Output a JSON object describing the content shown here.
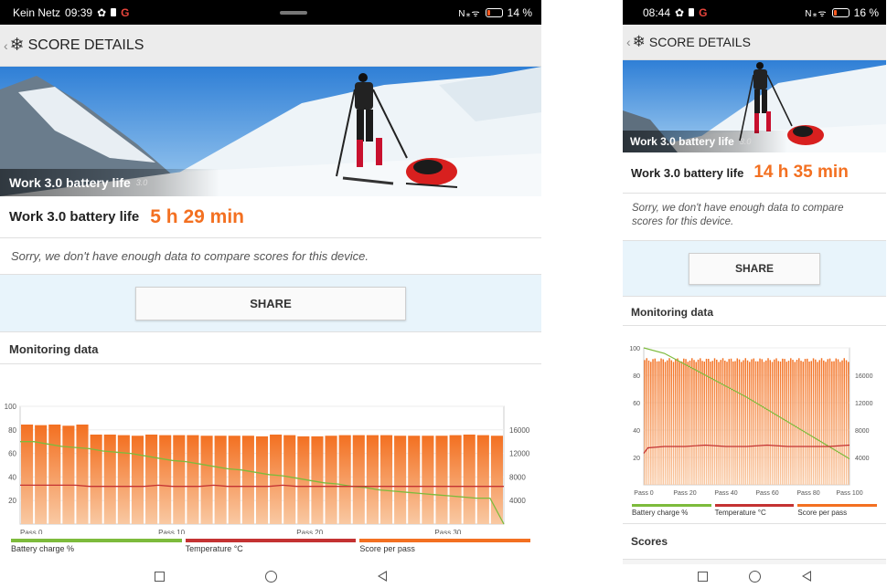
{
  "colors": {
    "accent": "#f37021",
    "battery_line": "#7dbb3c",
    "temp_line": "#c43232",
    "share_bg": "#e8f4fb"
  },
  "left": {
    "status": {
      "carrier": "Kein Netz",
      "time": "09:39",
      "icons": "N⁎ᯤ",
      "battery": "14 %"
    },
    "appbar": {
      "title": "SCORE DETAILS"
    },
    "hero": {
      "label": "Work 3.0 battery life",
      "version": "3.0"
    },
    "score": {
      "label": "Work 3.0 battery life",
      "value": "5 h 29 min"
    },
    "note": "Sorry, we don't have enough data to compare scores for this device.",
    "share_label": "SHARE",
    "monitoring_title": "Monitoring data",
    "legend": {
      "battery": "Battery charge %",
      "temperature": "Temperature °C",
      "score": "Score per pass"
    }
  },
  "right": {
    "status": {
      "time": "08:44",
      "icons": "N⁎ᯤ",
      "battery": "16 %"
    },
    "appbar": {
      "title": "SCORE DETAILS"
    },
    "hero": {
      "label": "Work 3.0 battery life",
      "version": "3.0"
    },
    "score": {
      "label": "Work 3.0 battery life",
      "value": "14 h 35 min"
    },
    "note": "Sorry, we don't have enough data to compare scores for this device.",
    "share_label": "SHARE",
    "monitoring_title": "Monitoring data",
    "legend": {
      "battery": "Battery charge %",
      "temperature": "Temperature °C",
      "score": "Score per pass"
    },
    "scores_title": "Scores"
  },
  "chart_data": [
    {
      "type": "bar",
      "series": [
        {
          "name": "Score per pass",
          "axis": "right",
          "values": [
            16900,
            16800,
            16900,
            16700,
            16900,
            15200,
            15200,
            15100,
            15000,
            15200,
            15100,
            15100,
            15100,
            15000,
            15000,
            15000,
            15000,
            14900,
            15200,
            15100,
            14900,
            14900,
            15000,
            15100,
            15100,
            15100,
            15100,
            15000,
            15000,
            15000,
            15000,
            15100,
            15200,
            15100,
            15000
          ]
        },
        {
          "name": "Battery charge %",
          "axis": "left",
          "values": [
            70,
            70,
            68,
            66,
            65,
            64,
            62,
            61,
            60,
            58,
            56,
            54,
            53,
            51,
            49,
            47,
            46,
            44,
            42,
            41,
            39,
            37,
            35,
            34,
            32,
            31,
            29,
            28,
            27,
            26,
            25,
            24,
            23,
            22,
            22,
            0
          ]
        },
        {
          "name": "Temperature °C",
          "axis": "left",
          "values": [
            33,
            33,
            33,
            33,
            33,
            32,
            32,
            32,
            32,
            32,
            33,
            32,
            32,
            32,
            33,
            32,
            32,
            32,
            32,
            33,
            32,
            32,
            32,
            32,
            32,
            32,
            32,
            32,
            32,
            32,
            32,
            32,
            32,
            32,
            32,
            32
          ]
        }
      ],
      "x_ticks": [
        "Pass 0",
        "Pass 10",
        "Pass 20",
        "Pass 30"
      ],
      "y_left_ticks": [
        "100",
        "80",
        "60",
        "40",
        "20"
      ],
      "y_right_ticks": [
        "16000",
        "12000",
        "8000",
        "4000"
      ],
      "ylim_left": [
        0,
        100
      ],
      "ylim_right": [
        0,
        20000
      ],
      "grid": true,
      "legend": "bottom"
    },
    {
      "type": "bar",
      "series": [
        {
          "name": "Score per pass",
          "axis": "right",
          "bars": 100,
          "value": 18500
        },
        {
          "name": "Battery charge %",
          "axis": "left",
          "points": [
            [
              0,
              100
            ],
            [
              10,
              96
            ],
            [
              20,
              88
            ],
            [
              30,
              80
            ],
            [
              40,
              72
            ],
            [
              50,
              64
            ],
            [
              60,
              55
            ],
            [
              70,
              46
            ],
            [
              80,
              37
            ],
            [
              90,
              28
            ],
            [
              100,
              19
            ]
          ]
        },
        {
          "name": "Temperature °C",
          "axis": "left",
          "points": [
            [
              0,
              23
            ],
            [
              2,
              27
            ],
            [
              10,
              28
            ],
            [
              20,
              28
            ],
            [
              30,
              29
            ],
            [
              40,
              28
            ],
            [
              50,
              28
            ],
            [
              60,
              29
            ],
            [
              70,
              28
            ],
            [
              80,
              28
            ],
            [
              90,
              28
            ],
            [
              100,
              29
            ]
          ]
        }
      ],
      "x_ticks": [
        "Pass 0",
        "Pass 20",
        "Pass 40",
        "Pass 60",
        "Pass 80",
        "Pass 100"
      ],
      "y_left_ticks": [
        "100",
        "80",
        "60",
        "40",
        "20"
      ],
      "y_right_ticks": [
        "16000",
        "12000",
        "8000",
        "4000"
      ],
      "ylim_left": [
        0,
        100
      ],
      "ylim_right": [
        0,
        20000
      ],
      "grid": true,
      "legend": "bottom"
    }
  ]
}
